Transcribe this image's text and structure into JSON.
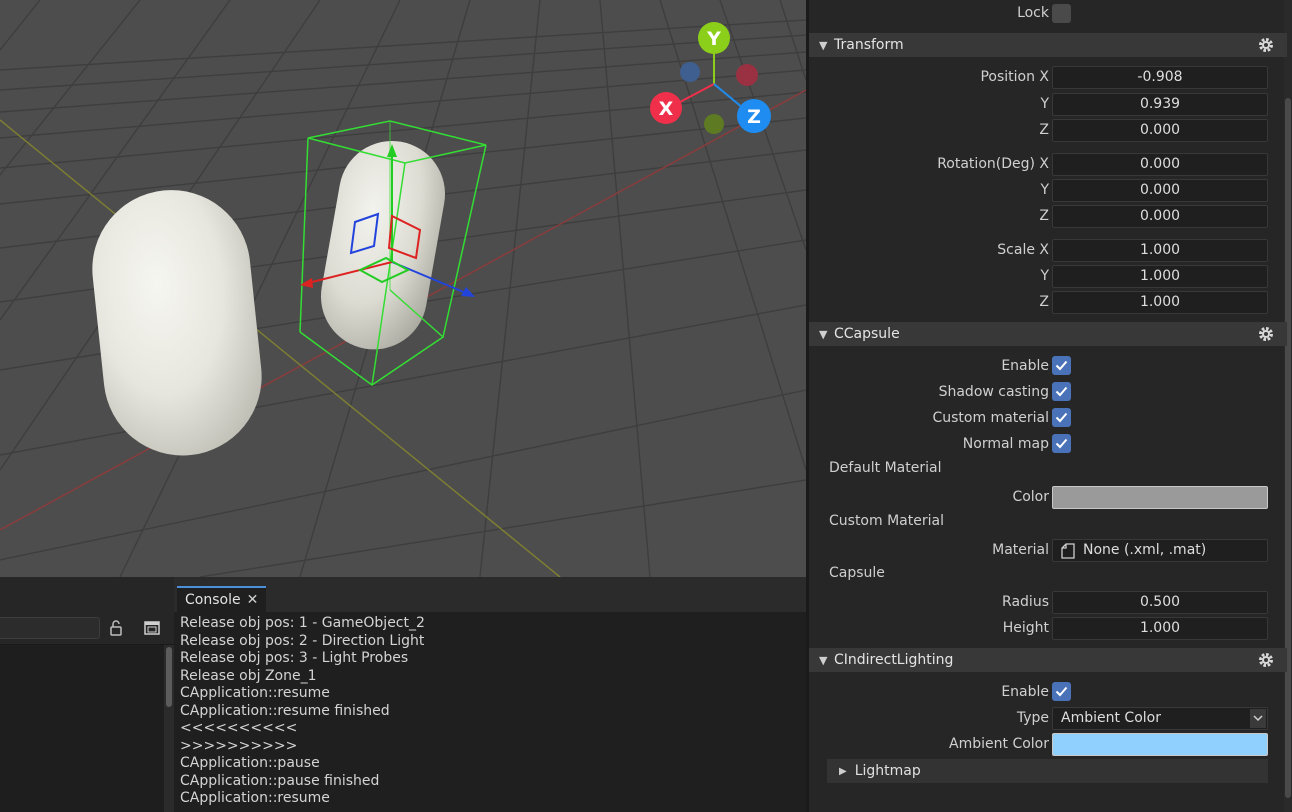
{
  "scene": {
    "gizmo": {
      "x_label": "X",
      "y_label": "Y",
      "z_label": "Z"
    }
  },
  "console": {
    "tab_label": "Console",
    "lines": [
      "Release obj pos: 1 - GameObject_2",
      "Release obj pos: 2 - Direction Light",
      "Release obj pos: 3 - Light Probes",
      "Release obj Zone_1",
      "CApplication::resume",
      "CApplication::resume finished",
      "<<<<<<<<<<",
      ">>>>>>>>>>",
      "CApplication::pause",
      "CApplication::pause finished",
      "CApplication::resume"
    ]
  },
  "inspector": {
    "lock_label": "Lock",
    "transform": {
      "title": "Transform",
      "position_label": "Position X",
      "rotation_label": "Rotation(Deg) X",
      "scale_label": "Scale X",
      "y_label": "Y",
      "z_label": "Z",
      "position": {
        "x": "-0.908",
        "y": "0.939",
        "z": "0.000"
      },
      "rotation": {
        "x": "0.000",
        "y": "0.000",
        "z": "0.000"
      },
      "scale": {
        "x": "1.000",
        "y": "1.000",
        "z": "1.000"
      }
    },
    "capsule": {
      "title": "CCapsule",
      "enable_label": "Enable",
      "shadow_label": "Shadow casting",
      "custom_material_label": "Custom material",
      "normal_map_label": "Normal map",
      "default_material_group": "Default Material",
      "color_label": "Color",
      "color_value": "#9a9a9a",
      "custom_material_group": "Custom Material",
      "material_label": "Material",
      "material_value": "None (.xml, .mat)",
      "capsule_group": "Capsule",
      "radius_label": "Radius",
      "radius_value": "0.500",
      "height_label": "Height",
      "height_value": "1.000"
    },
    "indirect": {
      "title": "CIndirectLighting",
      "enable_label": "Enable",
      "type_label": "Type",
      "type_value": "Ambient Color",
      "ambient_label": "Ambient Color",
      "ambient_value": "#8fd0ff",
      "lightmap_label": "Lightmap"
    }
  },
  "colors": {
    "accent": "#4a72b8",
    "axis_x": "#f0304a",
    "axis_y": "#8ccf1a",
    "axis_z": "#1e8cf0",
    "selection": "#33dd33"
  }
}
